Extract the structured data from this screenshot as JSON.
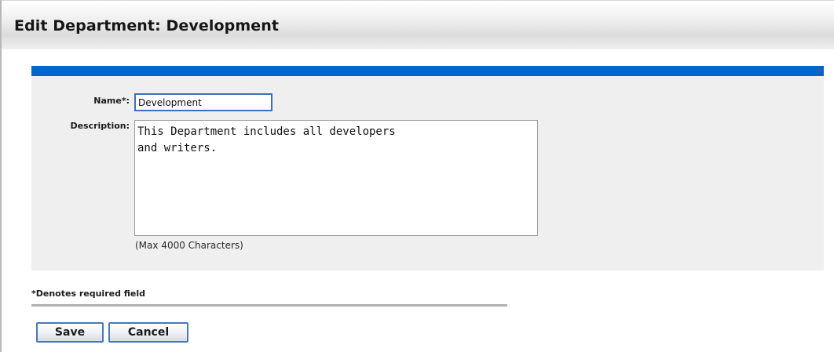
{
  "header": {
    "title": "Edit Department: Development"
  },
  "form": {
    "name_label": "Name*:",
    "name_value": "Development",
    "description_label": "Description:",
    "description_value": "This Department includes all developers\nand writers.",
    "description_note": "(Max 4000 Characters)"
  },
  "footer": {
    "required_note": "*Denotes required field"
  },
  "buttons": {
    "save_label": "Save",
    "cancel_label": "Cancel"
  },
  "colors": {
    "accent_bar": "#0066cc",
    "panel_background": "#efefef",
    "input_focus_border": "#3e6fb6"
  }
}
